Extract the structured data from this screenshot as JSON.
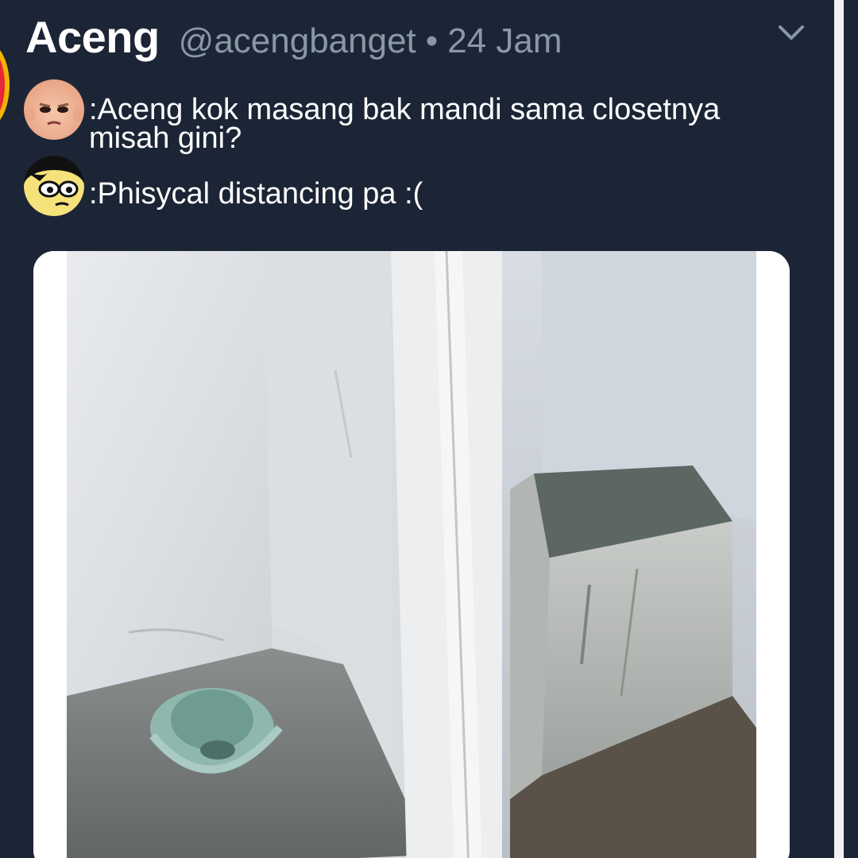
{
  "tweet": {
    "display_name": "Aceng",
    "handle": "@acengbanget",
    "separator": "•",
    "time": "24 Jam",
    "menu_icon": "chevron-down-icon",
    "lines": [
      {
        "avatar_icon": "boss-baby-avatar-icon",
        "text": ":Aceng kok masang bak mandi sama closetnya misah gini?"
      },
      {
        "avatar_icon": "cartoon-man-avatar-icon",
        "text": ":Phisycal distancing pa :("
      }
    ],
    "media_icon": "bathroom-photo"
  },
  "colors": {
    "background": "#1c2535",
    "text": "#ffffff",
    "muted": "#8899a6"
  }
}
